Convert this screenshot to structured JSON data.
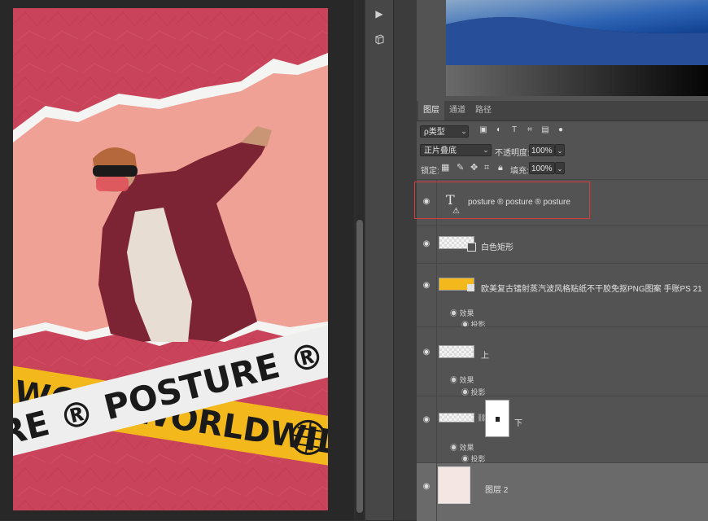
{
  "poster": {
    "band_top_text": "RE ® POSTURE ® P",
    "band_bottom_text": "WORLDWIDE",
    "band_bottom_left": "WO"
  },
  "panel": {
    "tabs": [
      "图层",
      "通道",
      "路径"
    ],
    "filter_kind": "ρ类型",
    "blend_mode": "正片叠底",
    "opacity_label": "不透明度:",
    "opacity_value": "100%",
    "lock_label": "锁定:",
    "fill_label": "填充:",
    "fill_value": "100%"
  },
  "layers": [
    {
      "name": "posture ® posture ® posture",
      "type": "text",
      "selected_highlight": true
    },
    {
      "name": "白色矩形",
      "type": "shape"
    },
    {
      "name": "欧美复古镭射蒸汽波风格贴纸不干胶免抠PNG图案 手账PS 21",
      "type": "smart",
      "effects_label": "效果",
      "effect": "投影"
    },
    {
      "name": "上",
      "type": "pixel",
      "effects_label": "效果",
      "effect": "投影"
    },
    {
      "name": "下",
      "type": "masked",
      "effects_label": "效果",
      "effect": "投影"
    },
    {
      "name": "图层 2",
      "type": "pixel",
      "active": true
    }
  ],
  "colors": {
    "accent_red": "#d93a3a",
    "poster_bg": "#c9435b",
    "tape_yellow": "#f2b81c"
  },
  "icons": [
    "play-icon",
    "cube-icon",
    "eye-icon",
    "text-layer-icon",
    "warning-icon",
    "effects-eye-icon"
  ]
}
